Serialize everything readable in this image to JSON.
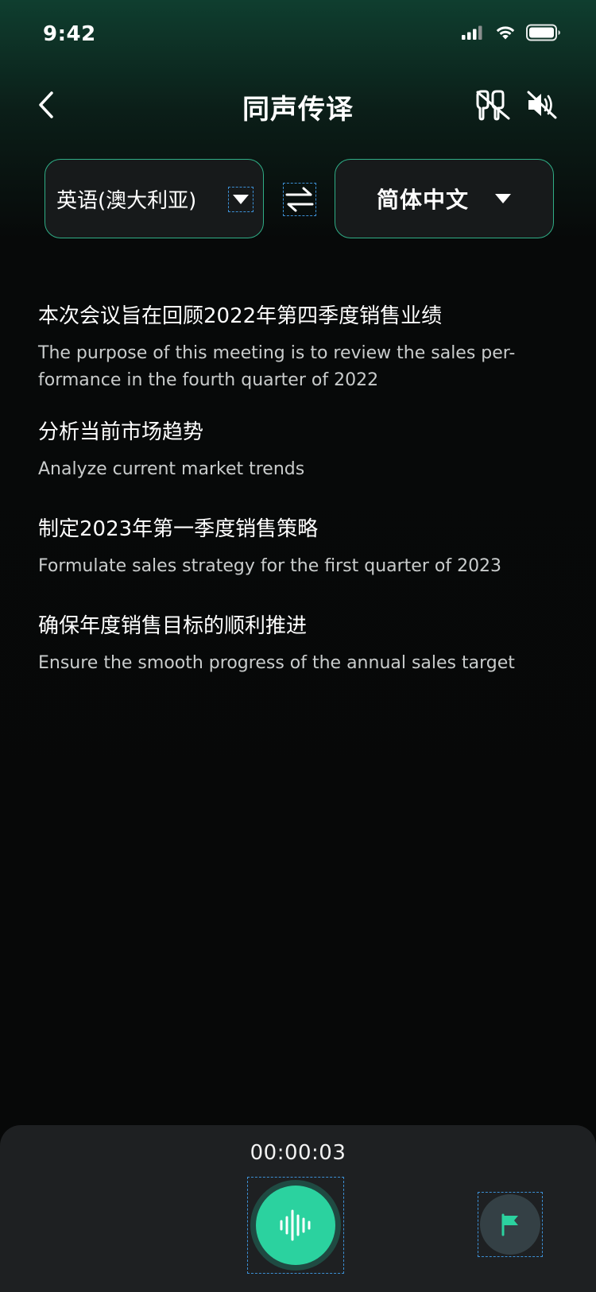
{
  "status_bar": {
    "time": "9:42"
  },
  "nav": {
    "title": "同声传译"
  },
  "language_bar": {
    "source_language": "英语(澳大利亚)",
    "target_language": "简体中文"
  },
  "transcript": [
    {
      "zh": "本次会议旨在回顾2022年第四季度销售业绩",
      "en": "The purpose of this meeting is to review the sales per-formance in the fourth quarter of 2022"
    },
    {
      "zh": "分析当前市场趋势",
      "en": "Analyze current market trends"
    },
    {
      "zh": "制定2023年第一季度销售策略",
      "en": "Formulate sales strategy for the first quarter of 2023"
    },
    {
      "zh": "确保年度销售目标的顺利推进",
      "en": "Ensure the smooth progress of the annual sales target"
    }
  ],
  "bottom_panel": {
    "timer": "00:00:03"
  },
  "colors": {
    "accent": "#2bd29f",
    "border_accent": "#2fae86",
    "panel": "#1e2022"
  },
  "icons": {
    "back": "chevron-left-icon",
    "earphone_off": "earphone-off-icon",
    "speaker_mute": "speaker-mute-icon",
    "dropdown": "caret-down-icon",
    "swap": "swap-arrows-icon",
    "mic": "voice-wave-icon",
    "flag": "flag-icon"
  }
}
